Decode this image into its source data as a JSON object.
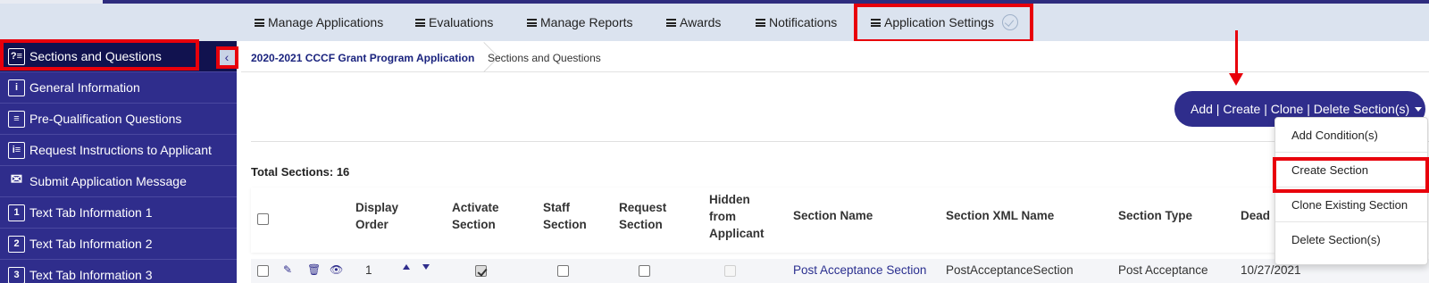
{
  "nav": {
    "items": [
      "Manage Applications",
      "Evaluations",
      "Manage Reports",
      "Awards",
      "Notifications",
      "Application Settings"
    ]
  },
  "sidebar": {
    "items": [
      {
        "label": "Sections and Questions",
        "icon": "?≡"
      },
      {
        "label": "General Information",
        "icon": "i"
      },
      {
        "label": "Pre-Qualification Questions",
        "icon": "≡"
      },
      {
        "label": "Request Instructions to Applicant",
        "icon": "i≡"
      },
      {
        "label": "Submit Application Message",
        "icon": "✉"
      },
      {
        "label": "Text Tab Information 1",
        "icon": "1"
      },
      {
        "label": "Text Tab Information 2",
        "icon": "2"
      },
      {
        "label": "Text Tab Information 3",
        "icon": "3"
      }
    ],
    "collapse_icon": "‹"
  },
  "breadcrumb": {
    "program": "2020-2021 CCCF Grant Program Application",
    "current": "Sections and Questions"
  },
  "actions": {
    "button_label": "Add | Create | Clone | Delete Section(s)",
    "menu": [
      "Add Condition(s)",
      "Create Section",
      "Clone Existing Section",
      "Delete Section(s)"
    ]
  },
  "summary": {
    "total_label": "Total Sections: 16"
  },
  "table": {
    "headers": {
      "display_order": [
        "Display",
        "Order"
      ],
      "activate": [
        "Activate",
        "Section"
      ],
      "staff": [
        "Staff",
        "Section"
      ],
      "request": [
        "Request",
        "Section"
      ],
      "hidden": [
        "Hidden",
        "from",
        "Applicant"
      ],
      "section_name": "Section Name",
      "section_xml": "Section XML Name",
      "section_type": "Section Type",
      "deadline": "Dead"
    },
    "rows": [
      {
        "order": "1",
        "activate": true,
        "staff": false,
        "request": false,
        "hidden": false,
        "section_name": "Post Acceptance Section",
        "section_xml": "PostAcceptanceSection",
        "section_type": "Post Acceptance",
        "deadline": "10/27/2021"
      }
    ]
  },
  "colors": {
    "primary": "#2f2d8c",
    "sidebar_active": "#11124f",
    "nav_bg": "#dbe3ef",
    "highlight": "#e8000b",
    "link": "#2a2f8f"
  }
}
